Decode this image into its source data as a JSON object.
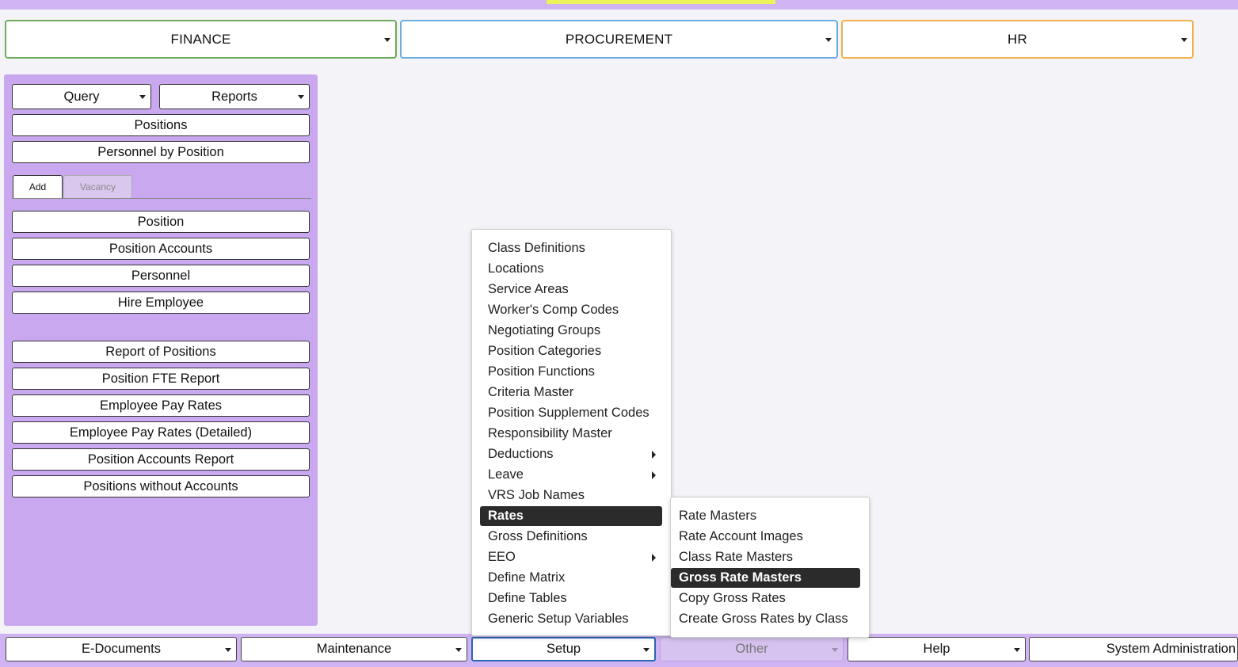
{
  "modules": [
    {
      "label": "FINANCE",
      "border_color": "#6aaa5a"
    },
    {
      "label": "PROCUREMENT",
      "border_color": "#6aaedf"
    },
    {
      "label": "HR",
      "border_color": "#f0b04a"
    }
  ],
  "sidebar": {
    "query_label": "Query",
    "reports_label": "Reports",
    "positions_label": "Positions",
    "personnel_by_position_label": "Personnel by Position",
    "tabs": [
      {
        "label": "Add",
        "active": true
      },
      {
        "label": "Vacancy",
        "active": false
      }
    ],
    "add_items": [
      "Position",
      "Position Accounts",
      "Personnel",
      "Hire Employee"
    ],
    "report_items": [
      "Report of Positions",
      "Position FTE Report",
      "Employee Pay Rates",
      "Employee Pay Rates (Detailed)",
      "Position Accounts Report",
      "Positions without Accounts"
    ]
  },
  "setup_menu": {
    "items": [
      {
        "label": "Class Definitions"
      },
      {
        "label": "Locations"
      },
      {
        "label": "Service Areas"
      },
      {
        "label": "Worker's Comp Codes"
      },
      {
        "label": "Negotiating Groups"
      },
      {
        "label": "Position Categories"
      },
      {
        "label": "Position Functions"
      },
      {
        "label": "Criteria Master"
      },
      {
        "label": "Position Supplement Codes"
      },
      {
        "label": "Responsibility Master"
      },
      {
        "label": "Deductions",
        "submenu": true
      },
      {
        "label": "Leave",
        "submenu": true
      },
      {
        "label": "VRS Job Names"
      },
      {
        "label": "Rates",
        "selected": true
      },
      {
        "label": "Gross Definitions"
      },
      {
        "label": "EEO",
        "submenu": true
      },
      {
        "label": "Define Matrix"
      },
      {
        "label": "Define Tables"
      },
      {
        "label": "Generic Setup Variables"
      }
    ]
  },
  "rates_submenu": {
    "items": [
      {
        "label": "Rate Masters"
      },
      {
        "label": "Rate Account Images"
      },
      {
        "label": "Class Rate Masters"
      },
      {
        "label": "Gross Rate Masters",
        "selected": true
      },
      {
        "label": "Copy Gross Rates"
      },
      {
        "label": "Create Gross Rates by Class"
      }
    ]
  },
  "bottom_nav": [
    {
      "label": "E-Documents"
    },
    {
      "label": "Maintenance"
    },
    {
      "label": "Setup",
      "focused": true
    },
    {
      "label": "Other",
      "disabled": true
    },
    {
      "label": "Help"
    },
    {
      "label": "System Administration"
    }
  ],
  "colors": {
    "accent_purple": "#c9a8f0",
    "highlight_yellow": "#eef25a",
    "selected_item": "#2b2b2b",
    "focus_border": "#2a67b5"
  }
}
